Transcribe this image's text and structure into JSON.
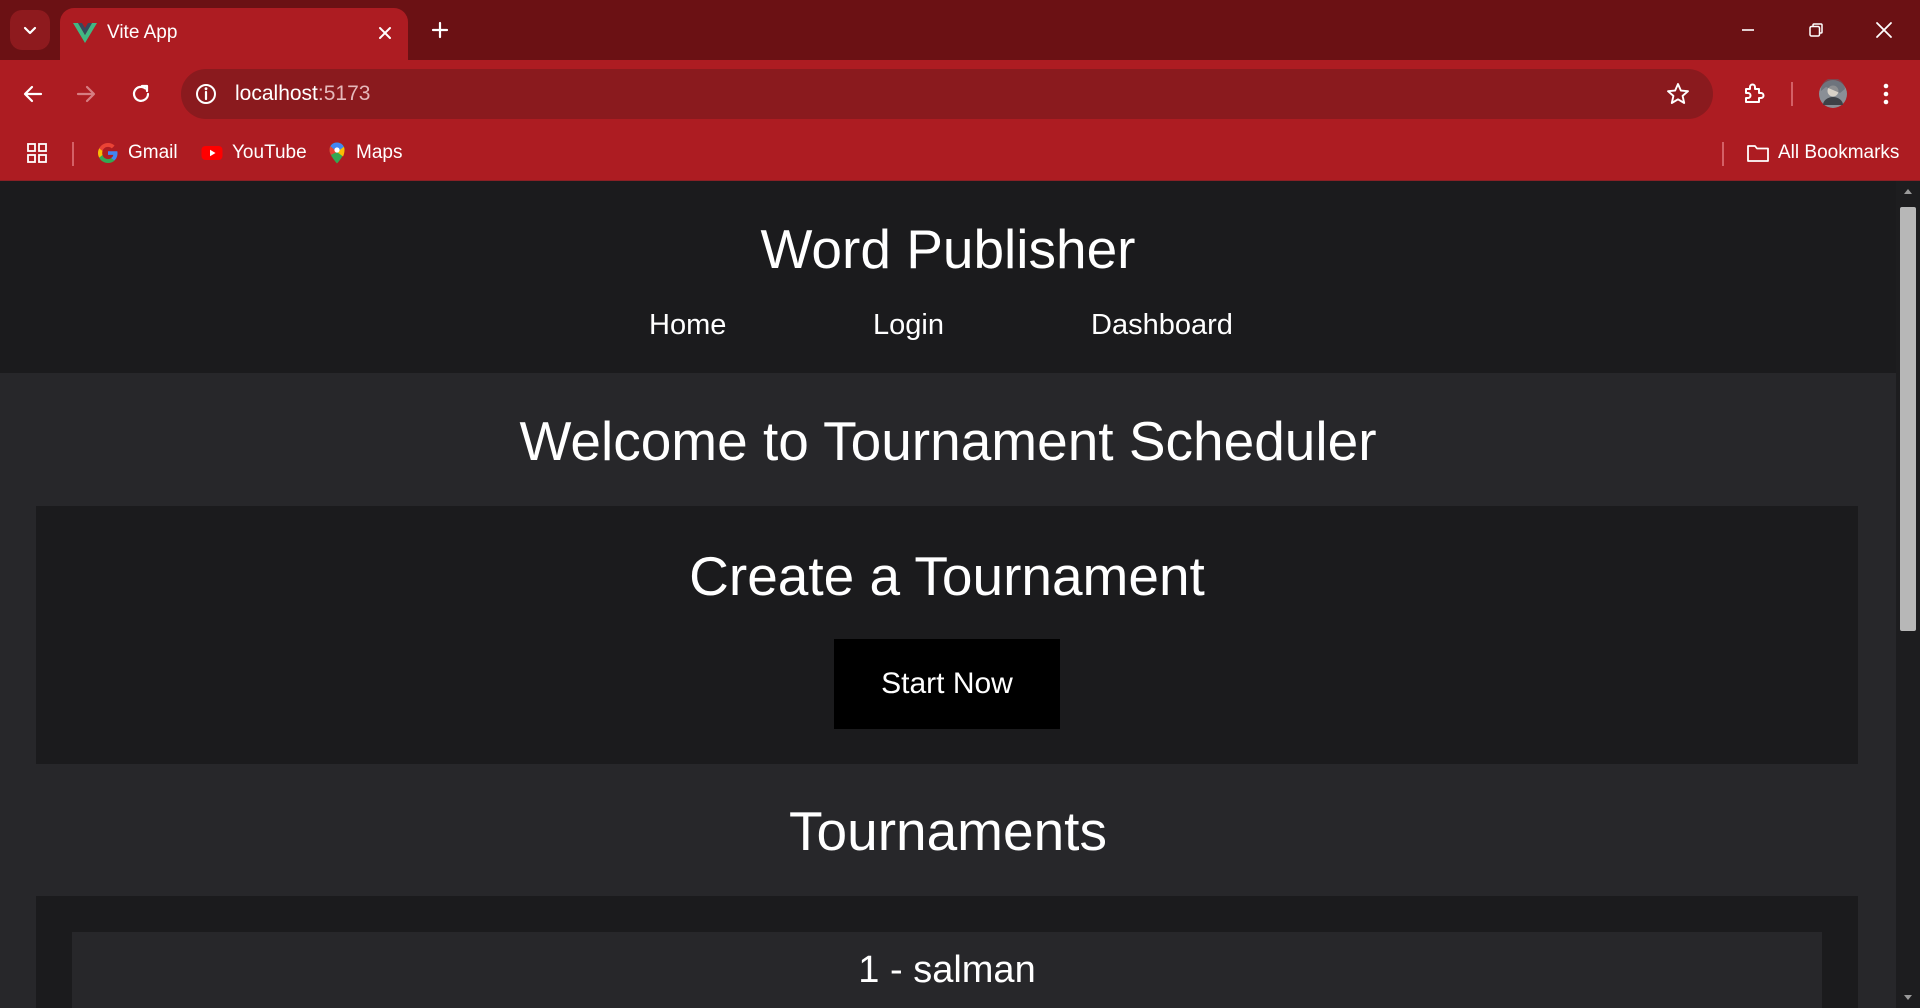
{
  "browser": {
    "tab": {
      "title": "Vite App"
    },
    "address": {
      "host": "localhost",
      "port": ":5173"
    },
    "bookmarks": [
      {
        "label": "Gmail",
        "icon": "google-icon"
      },
      {
        "label": "YouTube",
        "icon": "youtube-icon"
      },
      {
        "label": "Maps",
        "icon": "maps-icon"
      }
    ],
    "all_bookmarks_label": "All Bookmarks",
    "colors": {
      "tabstrip": "#6b1114",
      "toolbar": "#ad1c22",
      "omnibox": "#8a1a1e"
    }
  },
  "site": {
    "title": "Word Publisher",
    "nav": [
      {
        "label": "Home"
      },
      {
        "label": "Login"
      },
      {
        "label": "Dashboard"
      }
    ]
  },
  "main": {
    "welcome": "Welcome to Tournament Scheduler",
    "create": {
      "title": "Create a Tournament",
      "button_label": "Start Now"
    },
    "tournaments": {
      "title": "Tournaments",
      "items": [
        {
          "label": "1 - salman"
        }
      ]
    },
    "colors": {
      "background": "#27272a",
      "panel": "#1b1b1d",
      "button": "#000000",
      "text": "#ffffff"
    }
  }
}
